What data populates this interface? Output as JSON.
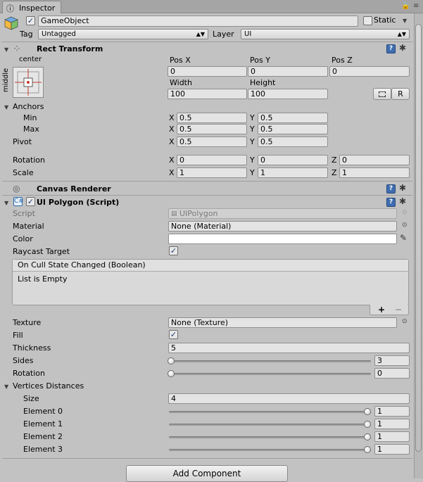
{
  "tab": {
    "label": "Inspector"
  },
  "object": {
    "name": "GameObject",
    "active": true,
    "static_label": "Static",
    "static_checked": false
  },
  "tag": {
    "label": "Tag",
    "value": "Untagged"
  },
  "layer": {
    "label": "Layer",
    "value": "UI"
  },
  "rect_transform": {
    "title": "Rect Transform",
    "anchor_preset_h": "center",
    "anchor_preset_v": "middle",
    "pos_x_label": "Pos X",
    "pos_y_label": "Pos Y",
    "pos_z_label": "Pos Z",
    "pos_x": "0",
    "pos_y": "0",
    "pos_z": "0",
    "width_label": "Width",
    "height_label": "Height",
    "width": "100",
    "height": "100",
    "r_button": "R",
    "anchors_label": "Anchors",
    "min_label": "Min",
    "min_x": "0.5",
    "min_y": "0.5",
    "max_label": "Max",
    "max_x": "0.5",
    "max_y": "0.5",
    "pivot_label": "Pivot",
    "pivot_x": "0.5",
    "pivot_y": "0.5",
    "rotation_label": "Rotation",
    "rot_x": "0",
    "rot_y": "0",
    "rot_z": "0",
    "scale_label": "Scale",
    "scale_x": "1",
    "scale_y": "1",
    "scale_z": "1",
    "x": "X",
    "y": "Y",
    "z": "Z"
  },
  "canvas_renderer": {
    "title": "Canvas Renderer"
  },
  "ui_polygon": {
    "title": "UI Polygon (Script)",
    "script_label": "Script",
    "script_value": "UIPolygon",
    "material_label": "Material",
    "material_value": "None (Material)",
    "color_label": "Color",
    "raycast_label": "Raycast Target",
    "raycast_checked": true,
    "event_title": "On Cull State Changed (Boolean)",
    "event_empty": "List is Empty",
    "plus": "+",
    "minus": "−",
    "texture_label": "Texture",
    "texture_value": "None (Texture)",
    "fill_label": "Fill",
    "fill_checked": true,
    "thickness_label": "Thickness",
    "thickness_value": "5",
    "sides_label": "Sides",
    "sides_value": "3",
    "sides_fraction": 0.0,
    "rotation_label": "Rotation",
    "rotation_value": "0",
    "rotation_fraction": 0.0,
    "vertices_label": "Vertices Distances",
    "size_label": "Size",
    "size_value": "4",
    "elements": [
      {
        "label": "Element 0",
        "value": "1",
        "fraction": 1.0
      },
      {
        "label": "Element 1",
        "value": "1",
        "fraction": 1.0
      },
      {
        "label": "Element 2",
        "value": "1",
        "fraction": 1.0
      },
      {
        "label": "Element 3",
        "value": "1",
        "fraction": 1.0
      }
    ]
  },
  "add_component": {
    "label": "Add Component"
  }
}
